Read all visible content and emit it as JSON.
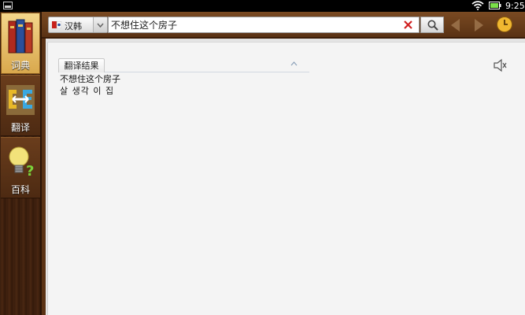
{
  "status_bar": {
    "time": "9:25"
  },
  "sidebar": {
    "items": [
      {
        "label": "词典",
        "icon": "books-icon",
        "active": true
      },
      {
        "label": "翻译",
        "icon": "ce-translate-icon",
        "active": false
      },
      {
        "label": "百科",
        "icon": "lightbulb-icon",
        "active": false
      }
    ]
  },
  "toolbar": {
    "language": "汉韩",
    "search_value": "不想住这个房子"
  },
  "result": {
    "tab_label": "翻译结果",
    "source_text": "不想住这个房子",
    "translation_text": "살 생각 이 집"
  },
  "colors": {
    "sidebar_wood": "#4a2712",
    "active_tab": "#e8c06a",
    "clear_x": "#d02020",
    "content_bg": "#f4f4f4"
  }
}
